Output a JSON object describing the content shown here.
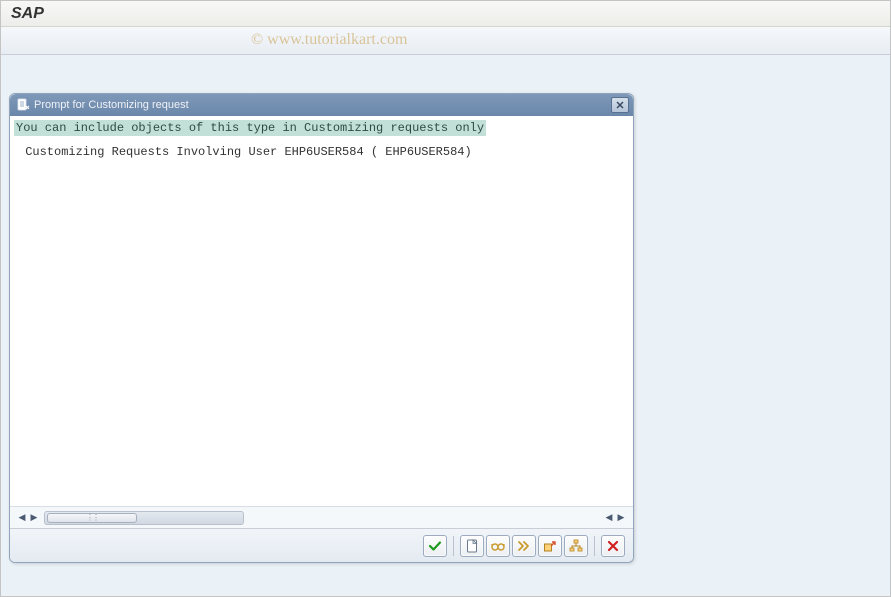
{
  "app": {
    "title": "SAP"
  },
  "watermark": "© www.tutorialkart.com",
  "dialog": {
    "title": "Prompt for Customizing request",
    "message": "You can include objects of this type in Customizing requests only",
    "user_line": " Customizing Requests Involving User EHP6USER584 ( EHP6USER584)"
  }
}
